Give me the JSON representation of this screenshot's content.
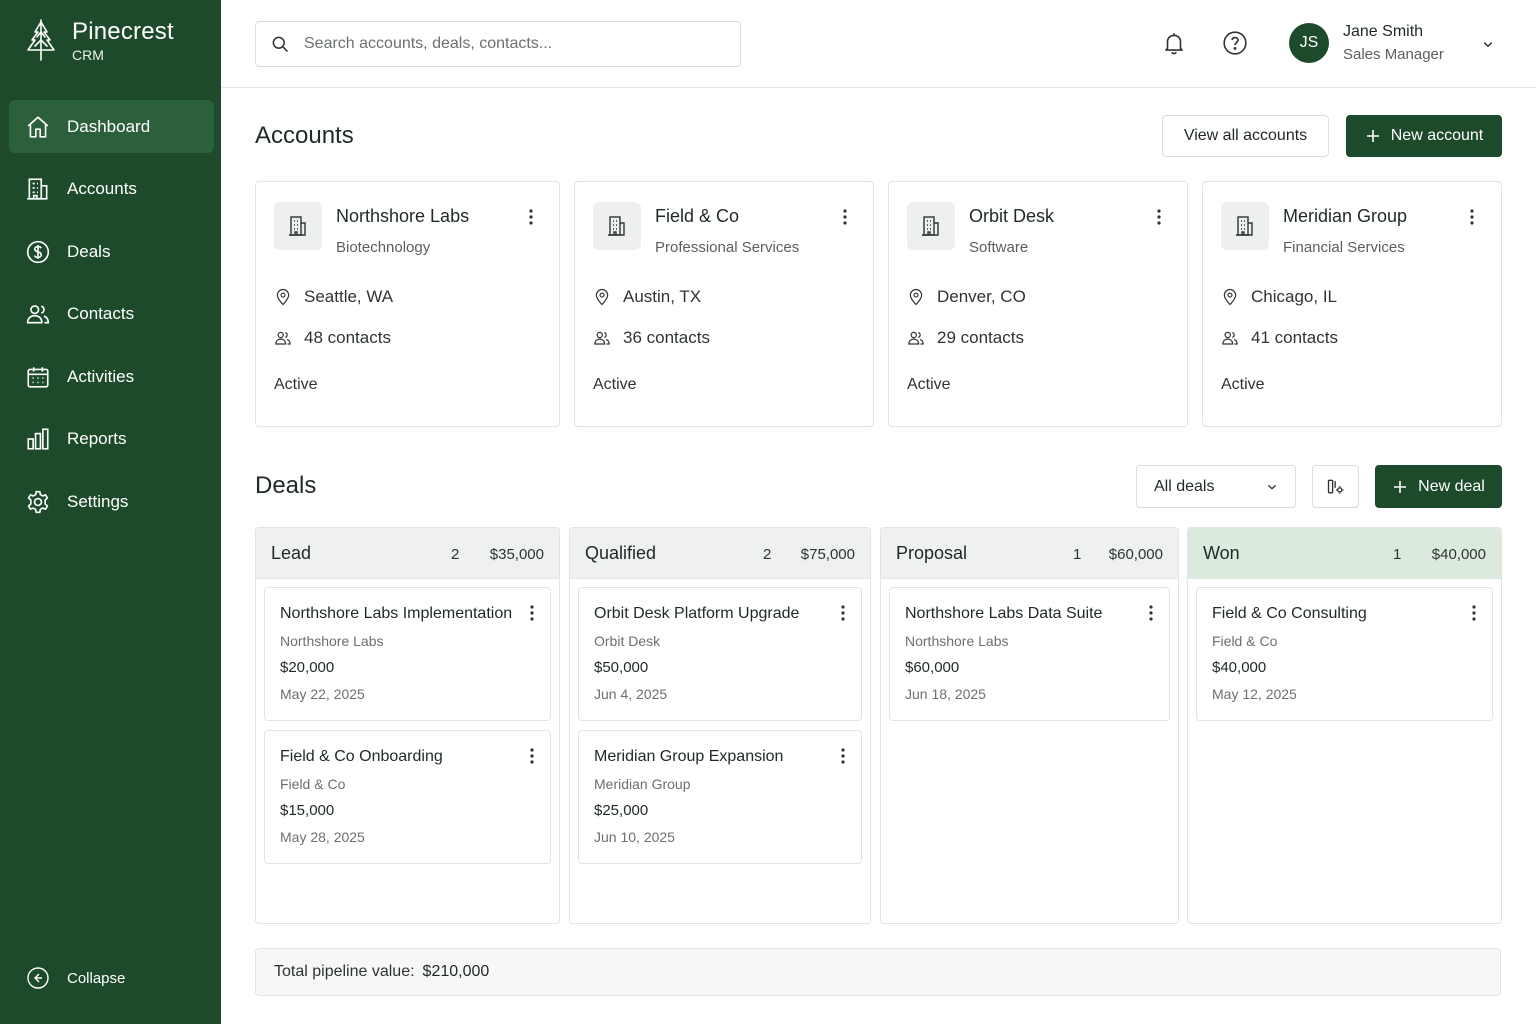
{
  "brand": {
    "name": "Pinecrest",
    "sub": "CRM"
  },
  "sidebar": {
    "items": [
      {
        "label": "Dashboard",
        "icon": "home-icon",
        "active": true
      },
      {
        "label": "Accounts",
        "icon": "building-icon"
      },
      {
        "label": "Deals",
        "icon": "dollar-icon"
      },
      {
        "label": "Contacts",
        "icon": "users-icon"
      },
      {
        "label": "Activities",
        "icon": "calendar-icon"
      },
      {
        "label": "Reports",
        "icon": "bar-chart-icon"
      },
      {
        "label": "Settings",
        "icon": "gear-icon"
      }
    ],
    "collapse_label": "Collapse"
  },
  "header": {
    "search_placeholder": "Search accounts, deals, contacts...",
    "user": {
      "initials": "JS",
      "name": "Jane Smith",
      "role": "Sales Manager"
    }
  },
  "accounts": {
    "title": "Accounts",
    "view_all_label": "View all accounts",
    "new_label": "New account",
    "cards": [
      {
        "name": "Northshore Labs",
        "industry": "Biotechnology",
        "location": "Seattle, WA",
        "contacts": "48 contacts",
        "status": "Active"
      },
      {
        "name": "Field & Co",
        "industry": "Professional Services",
        "location": "Austin, TX",
        "contacts": "36 contacts",
        "status": "Active"
      },
      {
        "name": "Orbit Desk",
        "industry": "Software",
        "location": "Denver, CO",
        "contacts": "29 contacts",
        "status": "Active"
      },
      {
        "name": "Meridian Group",
        "industry": "Financial Services",
        "location": "Chicago, IL",
        "contacts": "41 contacts",
        "status": "Active"
      }
    ]
  },
  "deals": {
    "title": "Deals",
    "filter_label": "All deals",
    "new_label": "New deal",
    "columns": [
      {
        "name": "Lead",
        "count": "2",
        "total": "$35,000",
        "deals": [
          {
            "name": "Northshore Labs Implementation",
            "account": "Northshore Labs",
            "value": "$20,000",
            "date": "May 22, 2025"
          },
          {
            "name": "Field & Co Onboarding",
            "account": "Field & Co",
            "value": "$15,000",
            "date": "May 28, 2025"
          }
        ]
      },
      {
        "name": "Qualified",
        "count": "2",
        "total": "$75,000",
        "deals": [
          {
            "name": "Orbit Desk Platform Upgrade",
            "account": "Orbit Desk",
            "value": "$50,000",
            "date": "Jun 4, 2025"
          },
          {
            "name": "Meridian Group Expansion",
            "account": "Meridian Group",
            "value": "$25,000",
            "date": "Jun 10, 2025"
          }
        ]
      },
      {
        "name": "Proposal",
        "count": "1",
        "total": "$60,000",
        "deals": [
          {
            "name": "Northshore Labs Data Suite",
            "account": "Northshore Labs",
            "value": "$60,000",
            "date": "Jun 18, 2025"
          }
        ]
      },
      {
        "name": "Won",
        "count": "1",
        "total": "$40,000",
        "deals": [
          {
            "name": "Field & Co Consulting",
            "account": "Field & Co",
            "value": "$40,000",
            "date": "May 12, 2025"
          }
        ]
      }
    ]
  },
  "footer": {
    "label": "Total pipeline value:",
    "value": "$210,000"
  },
  "colors": {
    "brand": "#1e4a2c",
    "brand_active": "#2c5f3c",
    "won_header": "#dceade"
  }
}
